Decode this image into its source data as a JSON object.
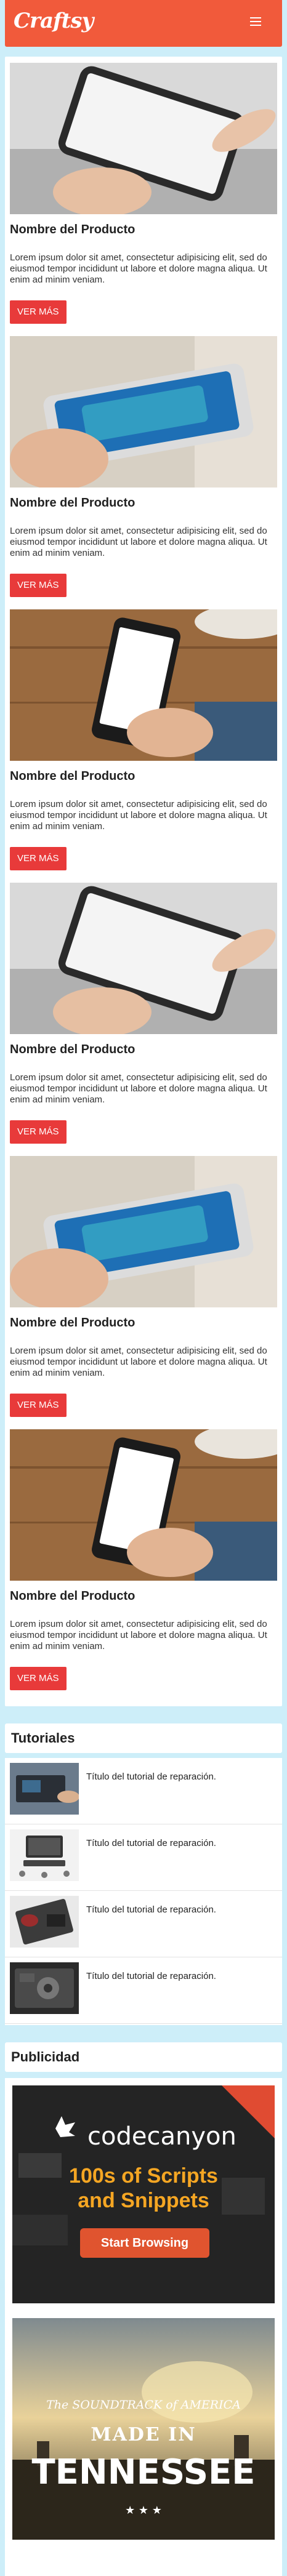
{
  "navbar": {
    "logo": "Craftsy",
    "menu_icon": "hamburger-icon"
  },
  "products": [
    {
      "name": "Nombre del Producto",
      "description": "Lorem ipsum dolor sit amet, consectetur adipisicing elit, sed do eiusmod tempor incididunt ut labore et dolore magna aliqua. Ut enim ad minim veniam.",
      "button": "VER MÁS"
    },
    {
      "name": "Nombre del Producto",
      "description": "Lorem ipsum dolor sit amet, consectetur adipisicing elit, sed do eiusmod tempor incididunt ut labore et dolore magna aliqua. Ut enim ad minim veniam.",
      "button": "VER MÁS"
    },
    {
      "name": "Nombre del Producto",
      "description": "Lorem ipsum dolor sit amet, consectetur adipisicing elit, sed do eiusmod tempor incididunt ut labore et dolore magna aliqua. Ut enim ad minim veniam.",
      "button": "VER MÁS"
    },
    {
      "name": "Nombre del Producto",
      "description": "Lorem ipsum dolor sit amet, consectetur adipisicing elit, sed do eiusmod tempor incididunt ut labore et dolore magna aliqua. Ut enim ad minim veniam.",
      "button": "VER MÁS"
    },
    {
      "name": "Nombre del Producto",
      "description": "Lorem ipsum dolor sit amet, consectetur adipisicing elit, sed do eiusmod tempor incididunt ut labore et dolore magna aliqua. Ut enim ad minim veniam.",
      "button": "VER MÁS"
    },
    {
      "name": "Nombre del Producto",
      "description": "Lorem ipsum dolor sit amet, consectetur adipisicing elit, sed do eiusmod tempor incididunt ut labore et dolore magna aliqua. Ut enim ad minim veniam.",
      "button": "VER MÁS"
    }
  ],
  "tutorials": {
    "heading": "Tutoriales",
    "items": [
      {
        "title": "Título del tutorial de reparación."
      },
      {
        "title": "Título del tutorial de reparación."
      },
      {
        "title": "Título del tutorial de reparación."
      },
      {
        "title": "Título del tutorial de reparación."
      }
    ]
  },
  "ads": {
    "heading": "Publicidad",
    "codecanyon": {
      "brand": "codecanyon",
      "headline_1": "100s of Scripts",
      "headline_2": "and Snippets",
      "button": "Start Browsing"
    },
    "tennessee": {
      "line_1": "The SOUNDTRACK of AMERICA",
      "line_2": "MADE IN",
      "line_3": "TENNESSEE"
    }
  },
  "colors": {
    "brand": "#f15a3b",
    "button": "#e83a3a",
    "background": "#cdeef9"
  }
}
